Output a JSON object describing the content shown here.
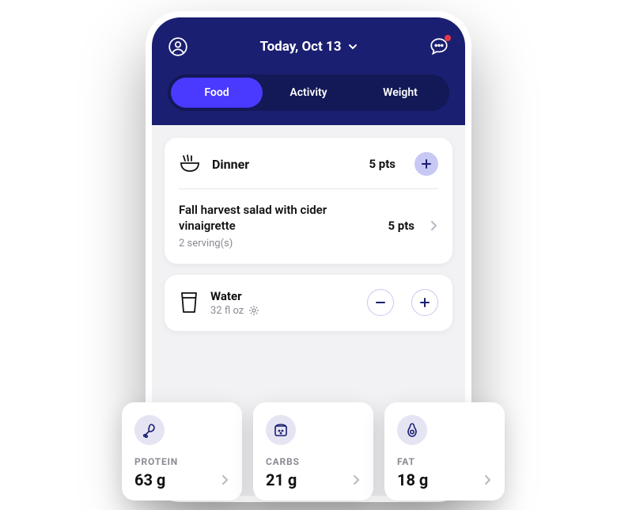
{
  "header": {
    "date_label": "Today, Oct 13",
    "tabs": [
      "Food",
      "Activity",
      "Weight"
    ],
    "active_tab": 0
  },
  "meal": {
    "name": "Dinner",
    "points": "5 pts",
    "items": [
      {
        "name": "Fall harvest salad with cider vinaigrette",
        "servings": "2 serving(s)",
        "points": "5 pts"
      }
    ]
  },
  "water": {
    "title": "Water",
    "amount": "32 fl oz"
  },
  "macros": [
    {
      "label": "PROTEIN",
      "value": "63 g",
      "icon": "drumstick"
    },
    {
      "label": "CARBS",
      "value": "21 g",
      "icon": "bread"
    },
    {
      "label": "FAT",
      "value": "18 g",
      "icon": "avocado"
    }
  ]
}
